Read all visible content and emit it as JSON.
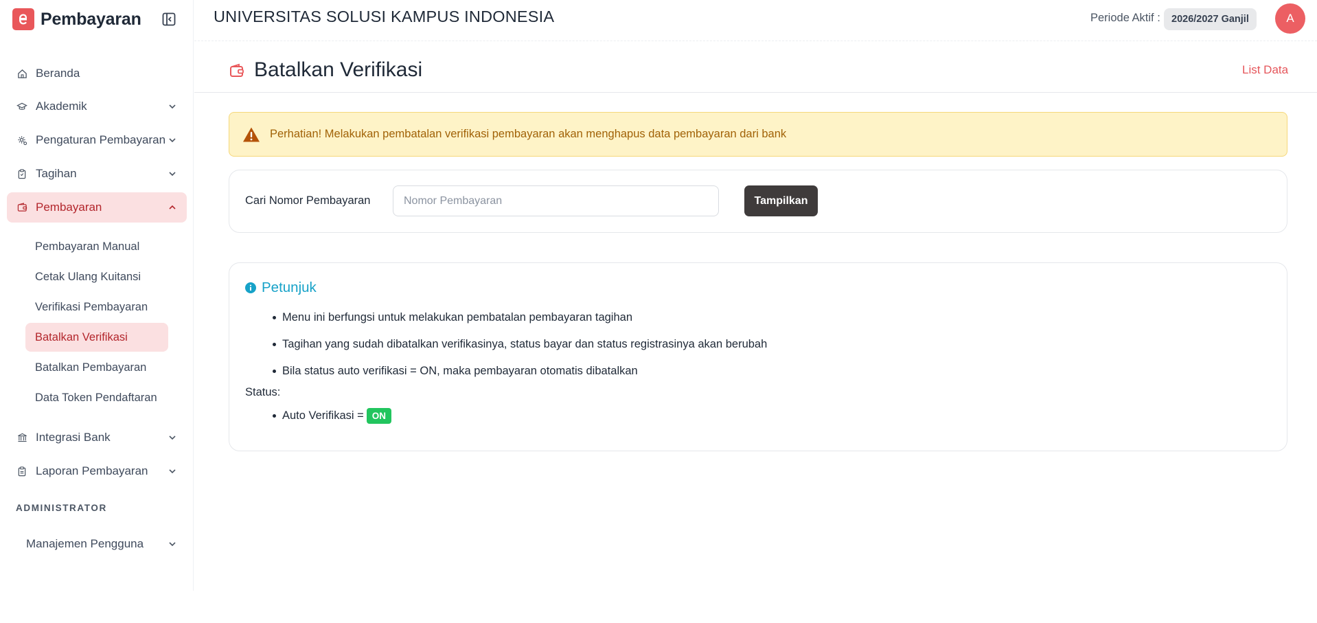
{
  "app": {
    "name": "Pembayaran"
  },
  "topbar": {
    "university": "UNIVERSITAS SOLUSI KAMPUS INDONESIA",
    "periode_label": "Periode Aktif :",
    "periode_value": "2026/2027 Ganjil",
    "avatar_initial": "A"
  },
  "sidebar": {
    "items": [
      {
        "label": "Beranda",
        "icon": "home-icon"
      },
      {
        "label": "Akademik",
        "icon": "graduation-cap-icon"
      },
      {
        "label": "Pengaturan Pembayaran",
        "icon": "settings-icon"
      },
      {
        "label": "Tagihan",
        "icon": "clipboard-icon"
      },
      {
        "label": "Pembayaran",
        "icon": "wallet-icon"
      }
    ],
    "sub_items": [
      {
        "label": "Pembayaran Manual"
      },
      {
        "label": "Cetak Ulang Kuitansi"
      },
      {
        "label": "Verifikasi Pembayaran"
      },
      {
        "label": "Batalkan Verifikasi"
      },
      {
        "label": "Batalkan Pembayaran"
      },
      {
        "label": "Data Token Pendaftaran"
      }
    ],
    "items_after": [
      {
        "label": "Integrasi Bank",
        "icon": "bank-icon"
      },
      {
        "label": "Laporan Pembayaran",
        "icon": "report-icon"
      }
    ],
    "section_label": "ADMINISTRATOR",
    "admin_item": {
      "label": "Manajemen Pengguna"
    }
  },
  "page": {
    "title": "Batalkan Verifikasi",
    "list_link": "List Data"
  },
  "alert": {
    "text": "Perhatian! Melakukan pembatalan verifikasi pembayaran akan menghapus data pembayaran dari bank"
  },
  "search": {
    "label": "Cari Nomor Pembayaran",
    "placeholder": "Nomor Pembayaran",
    "value": "",
    "button": "Tampilkan"
  },
  "info": {
    "title": "Petunjuk",
    "bullets": [
      "Menu ini berfungsi untuk melakukan pembatalan pembayaran tagihan",
      "Tagihan yang sudah dibatalkan verifikasinya, status bayar dan status registrasinya akan berubah",
      "Bila status auto verifikasi = ON, maka pembayaran otomatis dibatalkan"
    ],
    "status_label": "Status:",
    "status_item": "Auto Verifikasi =",
    "status_badge": "ON"
  },
  "colors": {
    "brand": "#e9575a",
    "active_bg": "#fbe0e1",
    "active_text": "#b3262c",
    "alert_bg": "#fef3c7",
    "alert_text": "#a16207",
    "info": "#17a2c8",
    "on_badge": "#22c55e",
    "button_dark": "#3f3b3b"
  }
}
